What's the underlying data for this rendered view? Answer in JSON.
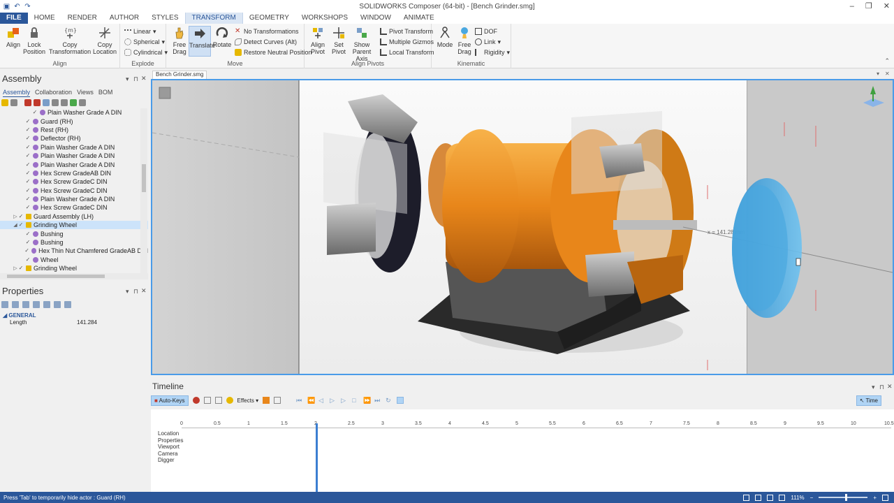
{
  "window": {
    "title": "SOLIDWORKS Composer (64-bit) - [Bench Grinder.smg]",
    "quick_access": [
      "save-icon",
      "undo-icon",
      "redo-icon"
    ],
    "controls": [
      "–",
      "❐",
      "✕"
    ]
  },
  "ribbon_tabs": [
    "FILE",
    "HOME",
    "RENDER",
    "AUTHOR",
    "STYLES",
    "TRANSFORM",
    "GEOMETRY",
    "WORKSHOPS",
    "WINDOW",
    "ANIMATE"
  ],
  "active_tab": "TRANSFORM",
  "ribbon": {
    "align_group": {
      "label": "Align",
      "align": "Align",
      "lock_position": [
        "Lock",
        "Position"
      ],
      "copy_transformation": [
        "Copy",
        "Transformation"
      ],
      "copy_location": [
        "Copy",
        "Location"
      ]
    },
    "explode_group": {
      "label": "Explode",
      "linear": "Linear",
      "spherical": "Spherical",
      "cylindrical": "Cylindrical"
    },
    "move_group": {
      "label": "Move",
      "free_drag": [
        "Free",
        "Drag"
      ],
      "translate": "Translate",
      "rotate": "Rotate",
      "no_transformations": "No Transformations",
      "detect_curves": "Detect Curves (Alt)",
      "restore_neutral": "Restore Neutral Position"
    },
    "align_pivots_group": {
      "label": "Align Pivots",
      "align_pivot": [
        "Align",
        "Pivot"
      ],
      "set_pivot": [
        "Set",
        "Pivot"
      ],
      "show_parent_axis": [
        "Show",
        "Parent Axis"
      ],
      "pivot_transform": "Pivot Transform",
      "multiple_gizmos": "Multiple Gizmos",
      "local_transform": "Local Transform"
    },
    "kinematic_group": {
      "label": "Kinematic",
      "mode": "Mode",
      "free_drag": [
        "Free",
        "Drag"
      ],
      "dof": "DOF",
      "link": "Link",
      "rigidity": "Rigidity"
    }
  },
  "assembly_panel": {
    "title": "Assembly",
    "subtabs": [
      "Assembly",
      "Collaboration",
      "Views",
      "BOM"
    ],
    "tree": [
      {
        "label": "Plain Washer Grade A DIN",
        "indent": 3,
        "type": "part",
        "expander": ""
      },
      {
        "label": "Guard (RH)",
        "indent": 2,
        "type": "part",
        "expander": ""
      },
      {
        "label": "Rest (RH)",
        "indent": 2,
        "type": "part",
        "expander": ""
      },
      {
        "label": "Deflector (RH)",
        "indent": 2,
        "type": "part",
        "expander": ""
      },
      {
        "label": "Plain Washer Grade A DIN",
        "indent": 2,
        "type": "part",
        "expander": ""
      },
      {
        "label": "Plain Washer Grade A DIN",
        "indent": 2,
        "type": "part",
        "expander": ""
      },
      {
        "label": "Plain Washer Grade A DIN",
        "indent": 2,
        "type": "part",
        "expander": ""
      },
      {
        "label": "Hex Screw GradeAB DIN",
        "indent": 2,
        "type": "part",
        "expander": ""
      },
      {
        "label": "Hex Screw GradeC DIN",
        "indent": 2,
        "type": "part",
        "expander": ""
      },
      {
        "label": "Hex Screw GradeC DIN",
        "indent": 2,
        "type": "part",
        "expander": ""
      },
      {
        "label": "Plain Washer Grade A DIN",
        "indent": 2,
        "type": "part",
        "expander": ""
      },
      {
        "label": "Hex Screw GradeC DIN",
        "indent": 2,
        "type": "part",
        "expander": ""
      },
      {
        "label": "Guard Assembly (LH)",
        "indent": 1,
        "type": "asm",
        "expander": "▷"
      },
      {
        "label": "Grinding Wheel",
        "indent": 1,
        "type": "asm",
        "expander": "◢",
        "selected": true
      },
      {
        "label": "Bushing",
        "indent": 2,
        "type": "part",
        "expander": ""
      },
      {
        "label": "Bushing",
        "indent": 2,
        "type": "part",
        "expander": ""
      },
      {
        "label": "Hex Thin Nut Chamfered GradeAB DIN",
        "indent": 2,
        "type": "part",
        "expander": ""
      },
      {
        "label": "Wheel",
        "indent": 2,
        "type": "part",
        "expander": ""
      },
      {
        "label": "Grinding Wheel",
        "indent": 1,
        "type": "asm",
        "expander": "▷"
      }
    ]
  },
  "properties_panel": {
    "title": "Properties",
    "section": "GENERAL",
    "rows": [
      {
        "key": "Length",
        "value": "141.284"
      }
    ]
  },
  "document": {
    "tab": "Bench Grinder.smg",
    "measure_label": "x = 141.28 mm"
  },
  "timeline": {
    "title": "Timeline",
    "auto_keys": "Auto-Keys",
    "effects": "Effects",
    "time_button": "Time",
    "ruler": [
      "0",
      "0.5",
      "1",
      "1.5",
      "2",
      "2.5",
      "3",
      "3.5",
      "4",
      "4.5",
      "5",
      "5.5",
      "6",
      "6.5",
      "7",
      "7.5",
      "8",
      "8.5",
      "9",
      "9.5",
      "10",
      "10.5"
    ],
    "tracks": [
      "Location",
      "Properties",
      "Viewport",
      "Camera",
      "Digger"
    ],
    "playhead_time": 2
  },
  "status": {
    "message": "Press 'Tab' to temporarily hide actor : Guard (RH)",
    "zoom": "111%"
  },
  "colors": {
    "accent": "#2b579a",
    "selection": "#4a9be8",
    "motor_orange": "#e88a1a",
    "wheel_blue": "#4aa8e0"
  }
}
